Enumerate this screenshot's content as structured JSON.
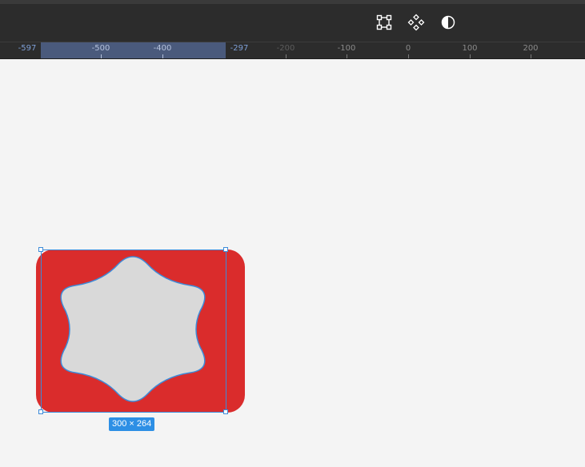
{
  "toolbar": {
    "tools": [
      {
        "name": "transform-tool",
        "icon": "bounding-box-icon"
      },
      {
        "name": "component-tool",
        "icon": "component-diamond-icon"
      },
      {
        "name": "contrast-tool",
        "icon": "half-circle-contrast-icon"
      }
    ]
  },
  "ruler": {
    "labels": [
      "-597",
      "-500",
      "-400",
      "-297",
      "-200",
      "-100",
      "0",
      "100",
      "200"
    ],
    "selection_start": "-597",
    "selection_end": "-297"
  },
  "selection": {
    "dimensions": "300 × 264"
  },
  "colors": {
    "toolbar_bg": "#2c2c2c",
    "canvas_bg": "#f4f4f4",
    "rect_fill": "#da2c2c",
    "star_fill": "#d9d9d9",
    "selection_accent": "#2d8fe5"
  }
}
